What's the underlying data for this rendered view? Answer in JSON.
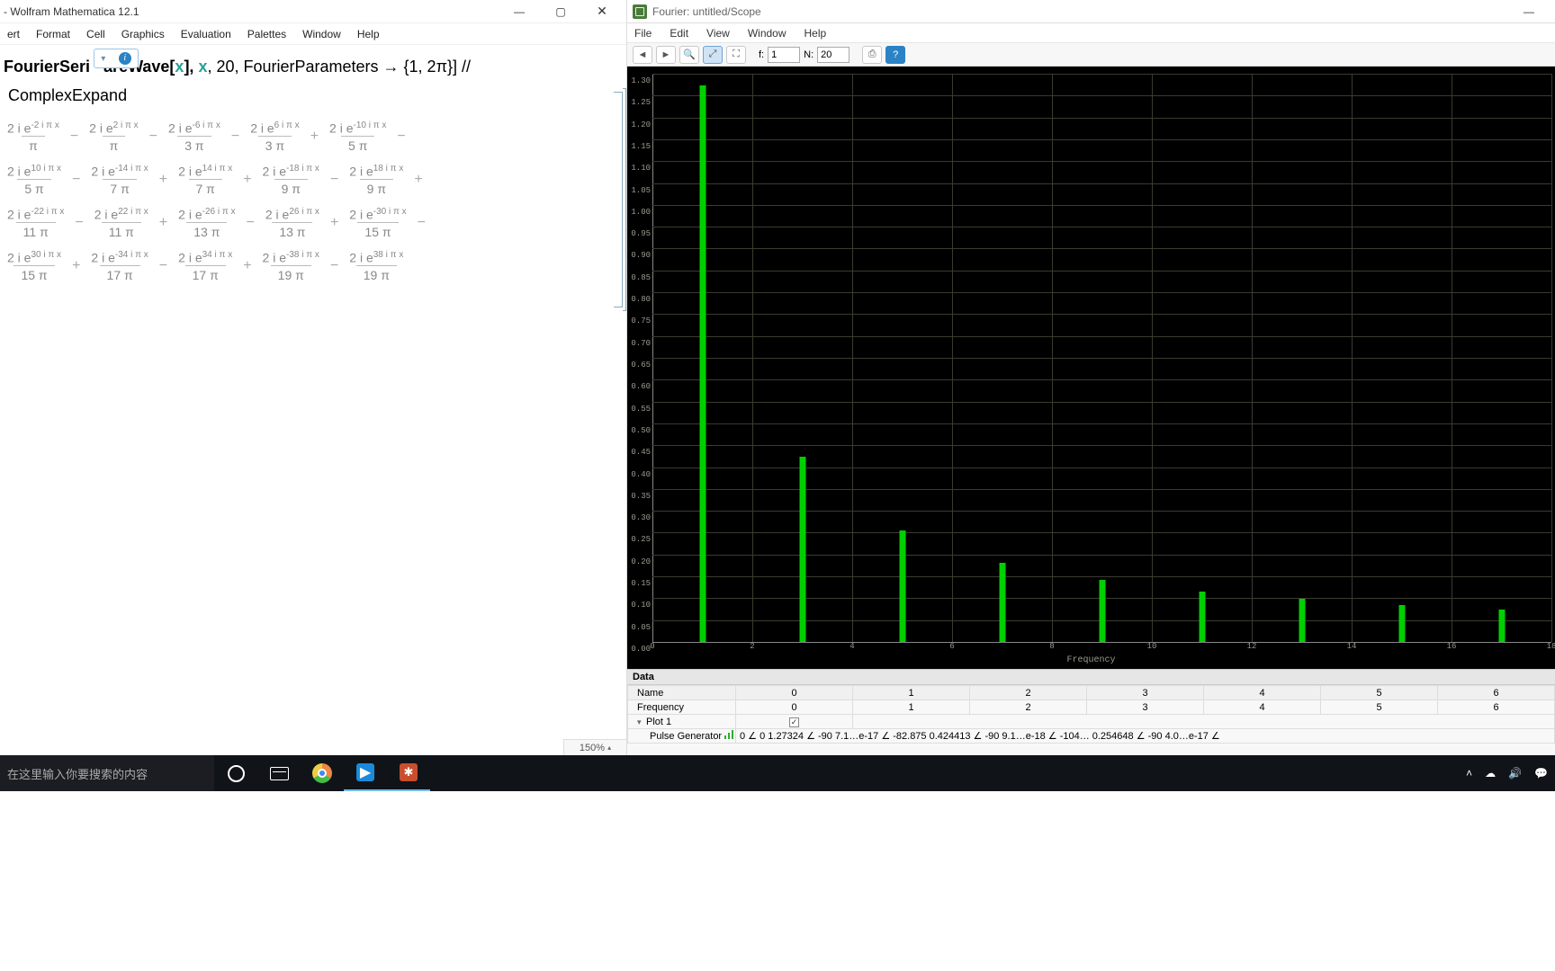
{
  "mathematica": {
    "title": " - Wolfram Mathematica 12.1",
    "menu": [
      "ert",
      "Format",
      "Cell",
      "Graphics",
      "Evaluation",
      "Palettes",
      "Window",
      "Help"
    ],
    "input": {
      "prefix": "FourierSeri",
      "mid": "areWave[",
      "var": "x",
      "rest1": "], ",
      "var2": "x",
      "rest2": ", 20, FourierParameters → {1, 2π}] //\n ComplexExpand"
    },
    "zoom": "150%",
    "output_rows": [
      [
        {
          "num": "2 i e",
          "sup": "-2 i π x",
          "den": "π"
        },
        "−",
        {
          "num": "2 i e",
          "sup": "2 i π x",
          "den": "π"
        },
        "−",
        {
          "num": "2 i e",
          "sup": "-6 i π x",
          "den": "3 π"
        },
        "−",
        {
          "num": "2 i e",
          "sup": "6 i π x",
          "den": "3 π"
        },
        "+",
        {
          "num": "2 i e",
          "sup": "-10 i π x",
          "den": "5 π"
        },
        "−"
      ],
      [
        {
          "num": "2 i e",
          "sup": "10 i π x",
          "den": "5 π"
        },
        "−",
        {
          "num": "2 i e",
          "sup": "-14 i π x",
          "den": "7 π"
        },
        "+",
        {
          "num": "2 i e",
          "sup": "14 i π x",
          "den": "7 π"
        },
        "+",
        {
          "num": "2 i e",
          "sup": "-18 i π x",
          "den": "9 π"
        },
        "−",
        {
          "num": "2 i e",
          "sup": "18 i π x",
          "den": "9 π"
        },
        "+"
      ],
      [
        {
          "num": "2 i e",
          "sup": "-22 i π x",
          "den": "11 π"
        },
        "−",
        {
          "num": "2 i e",
          "sup": "22 i π x",
          "den": "11 π"
        },
        "+",
        {
          "num": "2 i e",
          "sup": "-26 i π x",
          "den": "13 π"
        },
        "−",
        {
          "num": "2 i e",
          "sup": "26 i π x",
          "den": "13 π"
        },
        "+",
        {
          "num": "2 i e",
          "sup": "-30 i π x",
          "den": "15 π"
        },
        "−"
      ],
      [
        {
          "num": "2 i e",
          "sup": "30 i π x",
          "den": "15 π"
        },
        "+",
        {
          "num": "2 i e",
          "sup": "-34 i π x",
          "den": "17 π"
        },
        "−",
        {
          "num": "2 i e",
          "sup": "34 i π x",
          "den": "17 π"
        },
        "+",
        {
          "num": "2 i e",
          "sup": "-38 i π x",
          "den": "19 π"
        },
        "−",
        {
          "num": "2 i e",
          "sup": "38 i π x",
          "den": "19 π"
        }
      ]
    ]
  },
  "scope": {
    "title": "Fourier: untitled/Scope",
    "menu": [
      "File",
      "Edit",
      "View",
      "Window",
      "Help"
    ],
    "toolbar": {
      "f_label": "f:",
      "f_value": "1",
      "n_label": "N:",
      "n_value": "20"
    },
    "y_ticks": [
      "1.30",
      "1.25",
      "1.20",
      "1.15",
      "1.10",
      "1.05",
      "1.00",
      "0.95",
      "0.90",
      "0.85",
      "0.80",
      "0.75",
      "0.70",
      "0.65",
      "0.60",
      "0.55",
      "0.50",
      "0.45",
      "0.40",
      "0.35",
      "0.30",
      "0.25",
      "0.20",
      "0.15",
      "0.10",
      "0.05",
      "0.00"
    ],
    "x_ticks": [
      "0",
      "2",
      "4",
      "6",
      "8",
      "10",
      "12",
      "14",
      "16",
      "18"
    ],
    "x_label": "Frequency",
    "data_panel": {
      "header": "Data",
      "name_label": "Name",
      "cols": [
        "0",
        "1",
        "2",
        "3",
        "4",
        "5",
        "6"
      ],
      "freq_label": "Frequency",
      "freq_vals": [
        "0",
        "1",
        "2",
        "3",
        "4",
        "5",
        "6"
      ],
      "plot_label": "Plot 1",
      "series_label": "Pulse Generator",
      "cells": [
        "0",
        "∠ 0",
        "1.27324",
        "∠ -90",
        "7.1…e-17",
        "∠ -82.875",
        "0.424413",
        "∠ -90",
        "9.1…e-18",
        "∠ -104…",
        "0.254648",
        "∠ -90",
        "4.0…e-17",
        "∠"
      ]
    }
  },
  "chart_data": {
    "type": "bar",
    "title": "",
    "xlabel": "Frequency",
    "ylabel": "",
    "ylim": [
      0,
      1.3
    ],
    "xlim": [
      0,
      18
    ],
    "x": [
      1,
      3,
      5,
      7,
      9,
      11,
      13,
      15,
      17
    ],
    "values": [
      1.27324,
      0.42441,
      0.25465,
      0.18189,
      0.14147,
      0.11575,
      0.09794,
      0.08488,
      0.0749
    ]
  },
  "taskbar": {
    "search_placeholder": "在这里输入你要搜索的内容"
  }
}
